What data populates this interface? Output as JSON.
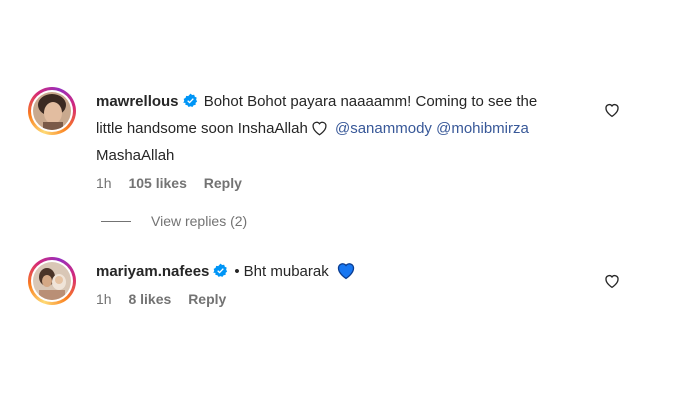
{
  "comments": [
    {
      "username": "mawrellous",
      "text_part1": "Bohot Bohot payara naaaamm! Coming to see the little handsome soon InshaAllah",
      "mention1": "@sanammody",
      "mention2": "@mohibmirza",
      "text_part2": "MashaAllah",
      "time": "1h",
      "likes": "105 likes",
      "reply": "Reply",
      "view_replies": "View replies (2)"
    },
    {
      "username": "mariyam.nafees",
      "bullet": "•",
      "text": "Bht mubarak",
      "time": "1h",
      "likes": "8 likes",
      "reply": "Reply"
    }
  ],
  "colors": {
    "verified": "#0095f6",
    "mention": "#385898",
    "secondary": "#737373",
    "blue_heart": "#1877f2"
  },
  "icons": [
    "verified-badge-icon",
    "heart-outline-icon",
    "blue-heart-emoji-icon"
  ]
}
